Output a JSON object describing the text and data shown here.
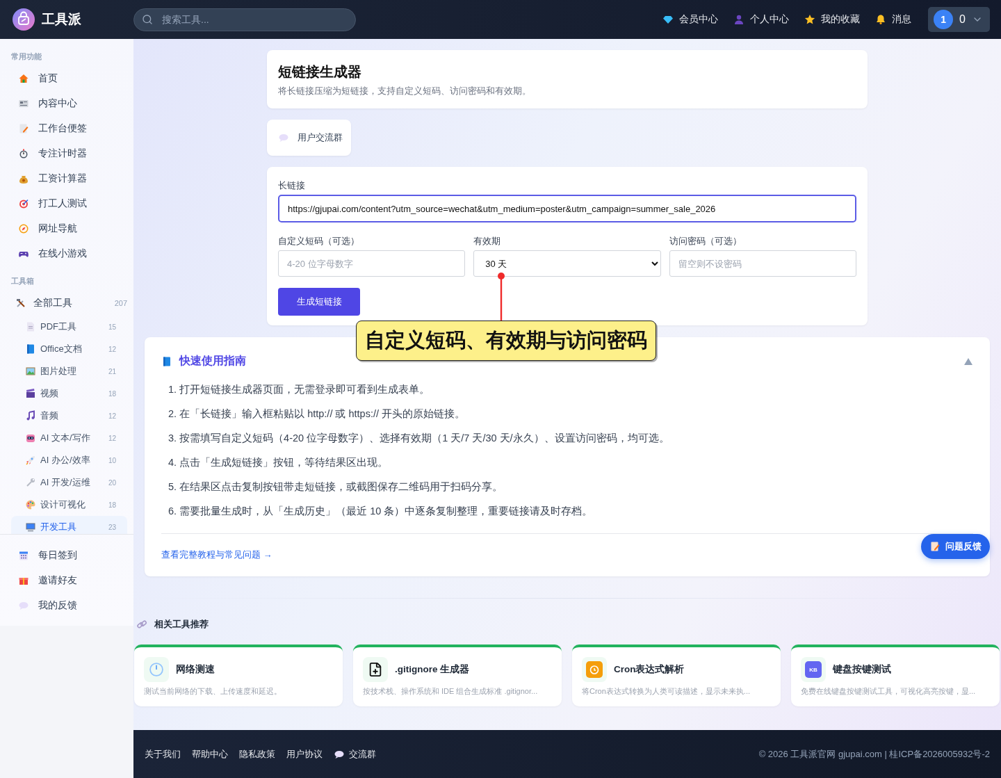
{
  "header": {
    "logo": "工具派",
    "search_placeholder": "搜索工具...",
    "nav": [
      {
        "label": "会员中心"
      },
      {
        "label": "个人中心"
      },
      {
        "label": "我的收藏"
      },
      {
        "label": "消息"
      }
    ],
    "avatar": "1",
    "count": "0"
  },
  "sidebar": {
    "sections": [
      {
        "title": "常用功能",
        "items": [
          {
            "label": "首页"
          },
          {
            "label": "内容中心"
          },
          {
            "label": "工作台便签"
          },
          {
            "label": "专注计时器"
          },
          {
            "label": "工资计算器"
          },
          {
            "label": "打工人测试"
          },
          {
            "label": "网址导航"
          },
          {
            "label": "在线小游戏"
          }
        ]
      },
      {
        "title": "工具箱",
        "items": [
          {
            "label": "全部工具",
            "count": "207",
            "children": [
              {
                "label": "PDF工具",
                "count": "15",
                "selected": false
              },
              {
                "label": "Office文档",
                "count": "12",
                "selected": false
              },
              {
                "label": "图片处理",
                "count": "21",
                "selected": false
              },
              {
                "label": "视频",
                "count": "18",
                "selected": false
              },
              {
                "label": "音频",
                "count": "12",
                "selected": false
              },
              {
                "label": "AI 文本/写作",
                "count": "12",
                "selected": false
              },
              {
                "label": "AI 办公/效率",
                "count": "10",
                "selected": false
              },
              {
                "label": "AI 开发/运维",
                "count": "20",
                "selected": false
              },
              {
                "label": "设计可视化",
                "count": "18",
                "selected": false
              },
              {
                "label": "开发工具",
                "count": "23",
                "selected": true
              }
            ]
          }
        ]
      }
    ],
    "bottom": [
      {
        "label": "每日签到"
      },
      {
        "label": "邀请好友"
      },
      {
        "label": "我的反馈"
      }
    ]
  },
  "tool": {
    "title": "短链接生成器",
    "subtitle": "将长链接压缩为短链接，支持自定义短码、访问密码和有效期。",
    "group_button": "用户交流群"
  },
  "form": {
    "long_url": {
      "label": "长链接",
      "value": "https://gjupai.com/content?utm_source=wechat&utm_medium=poster&utm_campaign=summer_sale_2026"
    },
    "short_code": {
      "label": "自定义短码（可选）",
      "placeholder": "4-20 位字母数字"
    },
    "expiry": {
      "label": "有效期",
      "value": "30 天"
    },
    "password": {
      "label": "访问密码（可选）",
      "placeholder": "留空则不设密码"
    },
    "submit": "生成短链接"
  },
  "callout": "自定义短码、有效期与访问密码",
  "guide": {
    "title": "快速使用指南",
    "expanded": true,
    "steps": [
      "1. 打开短链接生成器页面，无需登录即可看到生成表单。",
      "2. 在「长链接」输入框粘贴以 http:// 或 https:// 开头的原始链接。",
      "3. 按需填写自定义短码（4-20 位字母数字）、选择有效期（1 天/7 天/30 天/永久）、设置访问密码，均可选。",
      "4. 点击「生成短链接」按钮，等待结果区出现。",
      "5. 在结果区点击复制按钮带走短链接，或截图保存二维码用于扫码分享。",
      "6. 需要批量生成时，从「生成历史」（最近 10 条）中逐条复制整理，重要链接请及时存档。"
    ],
    "link": "查看完整教程与常见问题 →"
  },
  "feedback_button": "问题反馈",
  "related": {
    "title": "相关工具推荐",
    "cards": [
      {
        "title": "网络测速",
        "description": "测试当前网络的下载、上传速度和延迟。"
      },
      {
        "title": ".gitignore 生成器",
        "description": "按技术栈、操作系统和 IDE 组合生成标准 .gitignor..."
      },
      {
        "title": "Cron表达式解析",
        "description": "将Cron表达式转换为人类可读描述，显示未来执..."
      },
      {
        "title": "键盘按键测试",
        "description": "免费在线键盘按键测试工具，可视化高亮按键，显...",
        "badge": "KB"
      }
    ]
  },
  "footer": {
    "links": [
      "关于我们",
      "帮助中心",
      "隐私政策",
      "用户协议"
    ],
    "group": "交流群",
    "copyright": "© 2026 工具派官网 gjupai.com | 桂ICP备2026005932号-2"
  }
}
